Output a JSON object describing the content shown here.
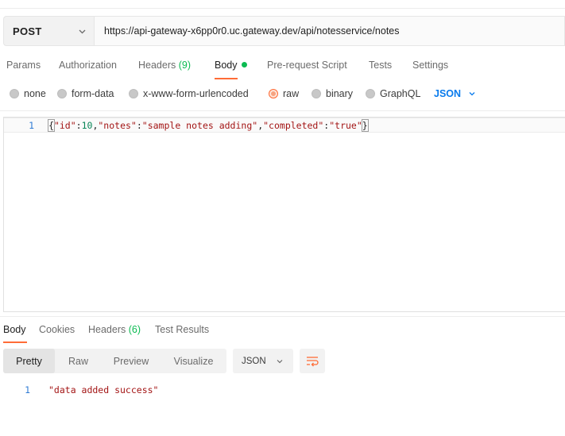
{
  "request": {
    "method": "POST",
    "url": "https://api-gateway-x6pp0r0.uc.gateway.dev/api/notesservice/notes"
  },
  "request_tabs": {
    "params": "Params",
    "authorization": "Authorization",
    "headers": "Headers",
    "headers_count": "(9)",
    "body": "Body",
    "prerequest": "Pre-request Script",
    "tests": "Tests",
    "settings": "Settings"
  },
  "body_types": {
    "none": "none",
    "form_data": "form-data",
    "urlencoded": "x-www-form-urlencoded",
    "raw": "raw",
    "binary": "binary",
    "graphql": "GraphQL",
    "selected": "raw",
    "language": "JSON"
  },
  "editor": {
    "line_number": "1",
    "tokens": {
      "open": "{",
      "k1": "\"id\"",
      "c1": ":",
      "v1": "10",
      "s1": ",",
      "k2": "\"notes\"",
      "c2": ":",
      "v2": "\"sample notes adding\"",
      "s2": ",",
      "k3": "\"completed\"",
      "c3": ":",
      "v3": "\"true\"",
      "close": "}"
    }
  },
  "response_tabs": {
    "body": "Body",
    "cookies": "Cookies",
    "headers": "Headers",
    "headers_count": "(6)",
    "test_results": "Test Results"
  },
  "response_view": {
    "modes": [
      "Pretty",
      "Raw",
      "Preview",
      "Visualize"
    ],
    "selected_mode": "Pretty",
    "language": "JSON"
  },
  "response_body": {
    "line_number": "1",
    "text": "\"data added success\""
  },
  "colors": {
    "accent": "#ff6c37",
    "status_green": "#0cbb52",
    "link_blue": "#097bed"
  },
  "icons": {
    "method_dropdown": "chevron-down-icon",
    "language_dropdown": "chevron-down-icon",
    "wrap": "wrap-lines-icon"
  }
}
